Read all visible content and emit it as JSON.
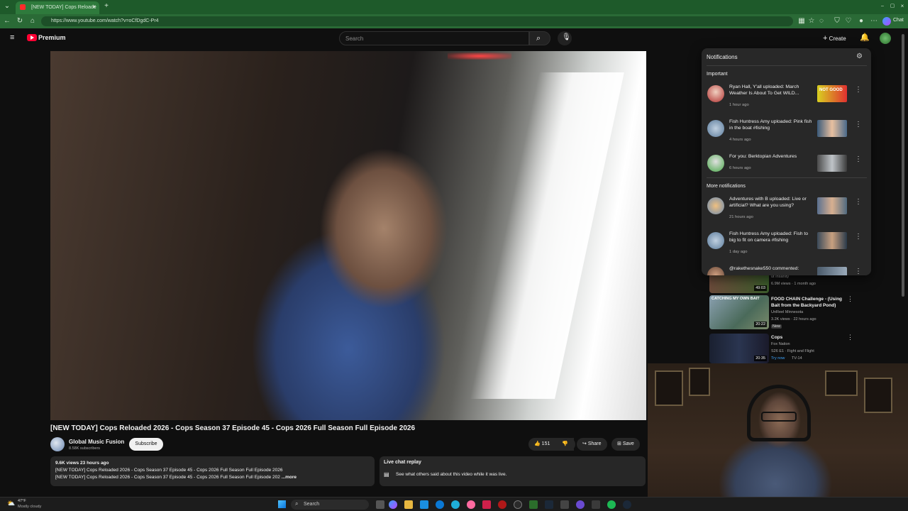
{
  "browser": {
    "tab_title": "[NEW TODAY] Cops Reloade",
    "url": "https://www.youtube.com/watch?v=oCfDgdC-Pr4",
    "chat_label": "Chat"
  },
  "header": {
    "logo_text": "Premium",
    "search_placeholder": "Search",
    "create_label": "Create"
  },
  "notifications": {
    "title": "Notifications",
    "important_label": "Important",
    "more_label": "More notifications",
    "important": [
      {
        "text": "Ryan Hall, Y'all uploaded: March Weather Is About To Get WILD...",
        "time": "1 hour ago",
        "thumb_text": "NOT GOOD"
      },
      {
        "text": "Fish Huntress Amy uploaded: Pink fish in the boat #fishing",
        "time": "4 hours ago"
      },
      {
        "text": "For you: Berktopian Adventures",
        "time": "6 hours ago"
      }
    ],
    "more": [
      {
        "text": "Adventures with B uploaded: Live or artificial? What are you using?",
        "time": "21 hours ago"
      },
      {
        "text": "Fish Huntress Amy uploaded: Fish to big to fit on camera #fishing",
        "time": "1 day ago"
      },
      {
        "text": "@rakethesnake550 commented:",
        "time": ""
      }
    ]
  },
  "related": [
    {
      "title": "",
      "channel": "ut Insanity",
      "meta": "6.9M views · 1 month ago",
      "duration": "49:03"
    },
    {
      "title": "FOOD CHAIN Challenge - (Using Bait from the Backyard Pond)",
      "channel": "UnReel Minnesota",
      "meta": "3.2K views · 22 hours ago",
      "badge": "New",
      "duration": "20:22",
      "thumb_text": "CATCHING MY OWN BAIT"
    },
    {
      "title": "Cops",
      "channel": "Fox Nation",
      "meta": "S26 E1 · Fight and Flight",
      "badge": "Try now",
      "rating": "TV-14",
      "duration": "20:35"
    }
  ],
  "video": {
    "title": "[NEW TODAY] Cops Reloaded 2026 - Cops Season 37 Episode 45 - Cops 2026 Full Season Full Episode 2026",
    "channel": "Global Music Fusion",
    "subscribers": "8.58K subscribers",
    "subscribe_label": "Subscribe",
    "likes": "151",
    "share_label": "Share",
    "save_label": "Save",
    "views_line": "9.6K views  23 hours ago",
    "desc_line1": "[NEW TODAY] Cops Reloaded 2026 - Cops Season 37 Episode 45 - Cops 2026 Full Season Full Episode 2026",
    "desc_line2": "[NEW TODAY] Cops Reloaded 2026 - Cops Season 37 Episode 45 - Cops 2026 Full Season Full Episode 202",
    "more_label": "...more",
    "live_chat_title": "Live chat replay",
    "live_chat_text": "See what others said about this video while it was live."
  },
  "taskbar": {
    "temperature": "47°F",
    "weather": "Mostly cloudy",
    "search_label": "Search"
  }
}
